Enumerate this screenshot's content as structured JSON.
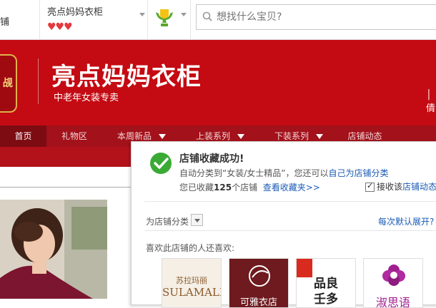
{
  "topbar": {
    "left_stub": "铺",
    "shop_name": "亮点妈妈衣柜",
    "rating_hearts": "♥♥♥",
    "search_placeholder": "想找什么宝贝?"
  },
  "banner": {
    "logo_text": "觇",
    "title": "亮点妈妈衣柜",
    "subtitle": "中老年女装专卖",
    "right_stub": "│倩"
  },
  "nav": {
    "items": [
      {
        "label": "首页"
      },
      {
        "label": "礼物区"
      },
      {
        "label": "本周新品"
      },
      {
        "label": "上装系列"
      },
      {
        "label": "下装系列"
      },
      {
        "label": "店铺动态"
      }
    ]
  },
  "popup": {
    "title": "店铺收藏成功!",
    "line1_prefix": "自动分类到“女装/女士精品”，您还可以",
    "line1_link": "自己为店铺分类",
    "line2_prefix": "您已收藏",
    "line2_count": "125",
    "line2_suffix": "个店铺",
    "line2_link": "查看收藏夹>>",
    "checkbox_prefix": "接收该",
    "checkbox_link": "店铺动态",
    "category_label": "为店铺分类",
    "default_expand_link": "每次默认展开?",
    "also_like_label": "喜欢此店铺的人还喜欢:",
    "related_shops": [
      {
        "line1": "苏拉玛丽",
        "line2": "SULAMALI"
      },
      {
        "line1": "可雅衣店",
        "line2": ""
      },
      {
        "line1": "品良",
        "line2": "壬多"
      },
      {
        "line1": "淑思语",
        "line2": ""
      }
    ]
  },
  "colors": {
    "brand_red": "#c40a12",
    "nav_red": "#a3111a",
    "nav_active": "#7c0b12",
    "link_blue": "#1a5bb5",
    "success_green": "#3aaa35"
  }
}
